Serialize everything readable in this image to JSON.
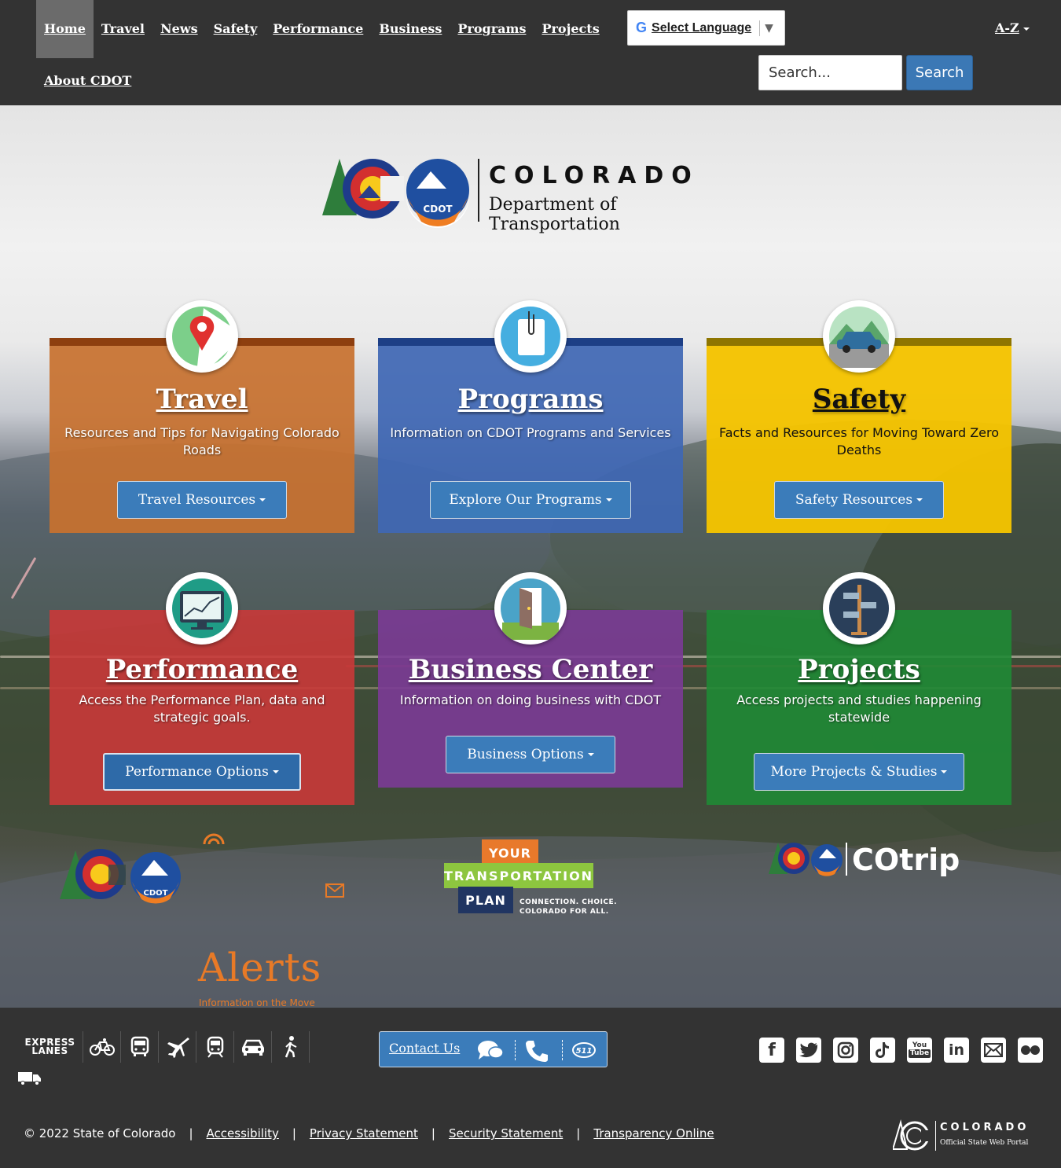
{
  "header": {
    "nav": [
      "Home",
      "Travel",
      "News",
      "Safety",
      "Performance",
      "Business",
      "Programs",
      "Projects"
    ],
    "about": "About CDOT",
    "language": "Select Language",
    "az": "A-Z",
    "search_placeholder": "Search...",
    "search_button": "Search"
  },
  "logo": {
    "state": "COLORADO",
    "dept": "Department of Transportation",
    "badge": "CDOT"
  },
  "cards": [
    {
      "title": "Travel",
      "desc": "Resources and Tips for Navigating Colorado Roads",
      "button": "Travel Resources",
      "icon": "map-pin-icon",
      "color": "#c8712f"
    },
    {
      "title": "Programs",
      "desc": "Information on CDOT Programs and Services",
      "button": "Explore Our Programs",
      "icon": "clipboard-icon",
      "color": "#3f67b4"
    },
    {
      "title": "Safety",
      "desc": "Facts and Resources for Moving Toward Zero Deaths",
      "button": "Safety Resources",
      "icon": "car-icon",
      "color": "#f5c400"
    },
    {
      "title": "Performance",
      "desc": "Access the Performance Plan, data and strategic goals.",
      "button": "Performance Options",
      "icon": "monitor-chart-icon",
      "color": "#c93838"
    },
    {
      "title": "Business Center",
      "desc": "Information on doing business with CDOT",
      "button": "Business Options",
      "icon": "door-icon",
      "color": "#7b3b96"
    },
    {
      "title": "Projects",
      "desc": "Access projects and studies happening statewide",
      "button": "More Projects & Studies",
      "icon": "signpost-icon",
      "color": "#1f8a35"
    }
  ],
  "promos": {
    "alerts": "Alerts",
    "alerts_sub": "Information on the Move",
    "alerts_badge": "CDOT",
    "ytp_your": "YOUR",
    "ytp_transportation": "TRANSPORTATION",
    "ytp_plan": "PLAN",
    "ytp_tagline1": "CONNECTION. CHOICE.",
    "ytp_tagline2": "COLORADO FOR ALL.",
    "cotrip": "COtrip"
  },
  "footer": {
    "express_lanes": "EXPRESS LANES",
    "contact": "Contact Us",
    "badge_511": "511",
    "copyright": "© 2022 State of Colorado",
    "links": [
      "Accessibility",
      "Privacy Statement",
      "Security Statement",
      "Transparency Online"
    ],
    "portal_title": "COLORADO",
    "portal_sub": "Official State Web Portal",
    "social": [
      "facebook-icon",
      "twitter-icon",
      "instagram-icon",
      "tiktok-icon",
      "youtube-icon",
      "linkedin-icon",
      "email-icon",
      "flickr-icon"
    ]
  }
}
